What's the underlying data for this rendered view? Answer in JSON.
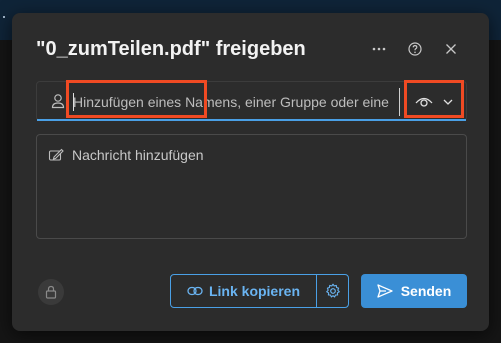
{
  "dialog": {
    "title": "\"0_zumTeilen.pdf\" freigeben",
    "more_icon": "more-options-icon",
    "help_icon": "help-icon",
    "close_icon": "close-icon"
  },
  "recipients": {
    "placeholder": "Hinzufügen eines Namens, einer Gruppe oder einer",
    "person_icon": "person-icon",
    "permission_icon": "eye-icon",
    "permission_dropdown_icon": "chevron-down-icon"
  },
  "message": {
    "placeholder": "Nachricht hinzufügen",
    "icon": "edit-icon"
  },
  "footer": {
    "lock_icon": "lock-icon",
    "copy_link_label": "Link kopieren",
    "link_icon": "link-icon",
    "settings_icon": "gear-icon",
    "send_label": "Senden",
    "send_icon": "send-icon"
  },
  "colors": {
    "accent": "#4aa0e6",
    "primary_button": "#3a8fd6",
    "highlight": "#f04a23",
    "dialog_bg": "#2c2c2c"
  }
}
